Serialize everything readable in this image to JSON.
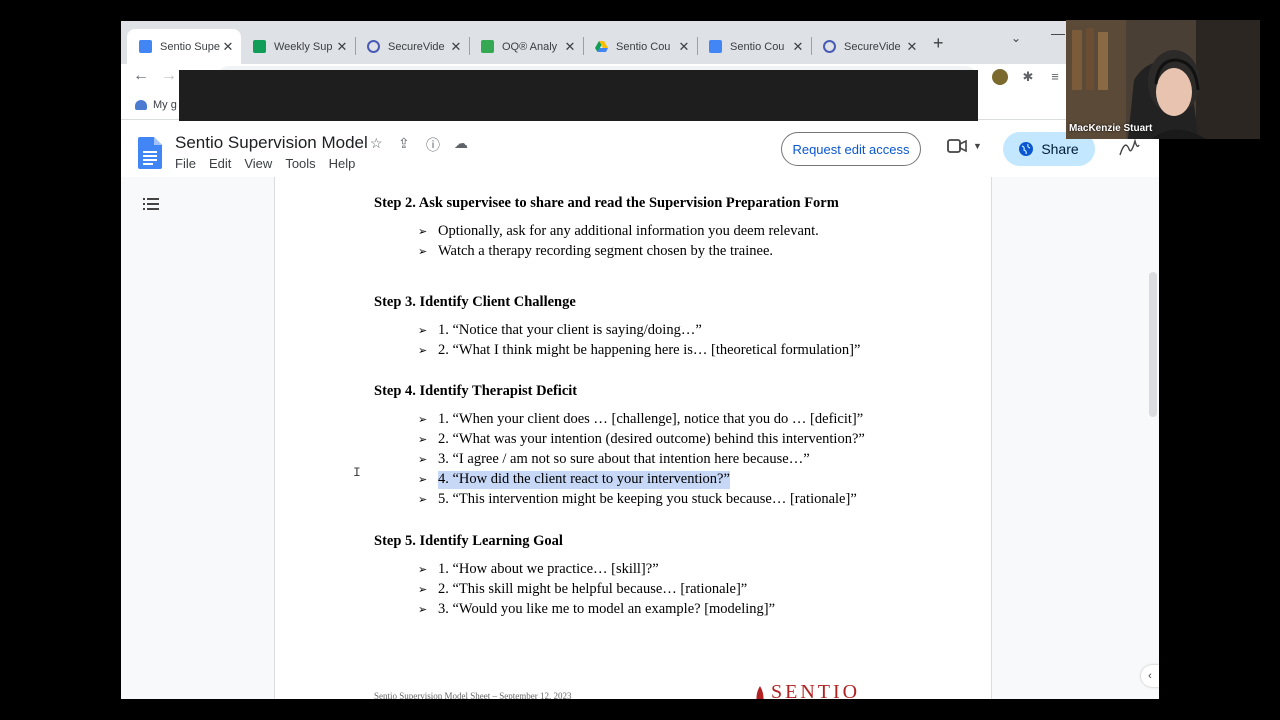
{
  "browser": {
    "tabs": [
      {
        "title": "Sentio Supe",
        "favicon": "google-docs-icon",
        "color": "#4285f4",
        "active": true
      },
      {
        "title": "Weekly Sup",
        "favicon": "google-sheets-icon",
        "color": "#0f9d58",
        "active": false
      },
      {
        "title": "SecureVide",
        "favicon": "securevideo-icon",
        "color": "#4a5bb5",
        "active": false
      },
      {
        "title": "OQ® Analy",
        "favicon": "oq-analyst-icon",
        "color": "#34a853",
        "active": false
      },
      {
        "title": "Sentio Cou",
        "favicon": "google-drive-icon",
        "color": "#fbbc04",
        "active": false
      },
      {
        "title": "Sentio Cou",
        "favicon": "google-docs-icon",
        "color": "#4285f4",
        "active": false
      },
      {
        "title": "SecureVide",
        "favicon": "securevideo-icon",
        "color": "#4a5bb5",
        "active": false
      }
    ],
    "new_tab_glyph": "+",
    "bookmark_label": "My g"
  },
  "doc": {
    "title": "Sentio Supervision Model",
    "menus": [
      "File",
      "Edit",
      "View",
      "Tools",
      "Help"
    ],
    "request_edit_label": "Request edit access",
    "share_label": "Share",
    "steps": [
      {
        "heading": "Step 2. Ask supervisee to share and read the Supervision Preparation Form",
        "bullets": [
          "Optionally, ask for any additional information you deem relevant.",
          "Watch a therapy recording segment chosen by the trainee."
        ]
      },
      {
        "heading": "Step 3. Identify Client Challenge",
        "bullets": [
          "1. “Notice that your client is saying/doing…”",
          "2. “What I think might be happening here is… [theoretical formulation]”"
        ]
      },
      {
        "heading": "Step 4. Identify Therapist Deficit",
        "bullets": [
          "1. “When your client does … [challenge], notice that you do … [deficit]”",
          "2. “What was your intention (desired outcome) behind this intervention?”",
          "3. “I agree / am not so sure about that intention here because…”",
          "4. “How did the client react to your intervention?”",
          "5. “This intervention might be keeping you stuck because… [rationale]”"
        ]
      },
      {
        "heading": "Step 5. Identify Learning Goal",
        "bullets": [
          "1. “How about we practice… [skill]?”",
          "2. “This skill might be helpful because… [rationale]”",
          "3. “Would you like me to model an example? [modeling]”"
        ]
      }
    ],
    "footer_text": "Sentio Supervision Model Sheet – September 12, 2023",
    "logo_text": "SENTIO"
  },
  "webcam": {
    "participant_name": "MacKenzie Stuart"
  },
  "colors": {
    "accent_blue": "#0b57d0",
    "share_bg": "#c2e7ff",
    "selection": "#c7d8f7"
  }
}
